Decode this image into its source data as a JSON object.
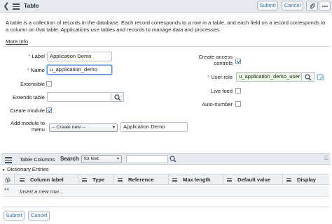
{
  "header": {
    "back_icon": "chevron-left-icon",
    "menu_icon": "hamburger-icon",
    "title": "Table",
    "submit_label": "Submit",
    "cancel_label": "Cancel",
    "attachment_icon": "paperclip-icon",
    "more_icon": "more-options-icon"
  },
  "description": "A table is a collection of records in the database. Each record corresponds to a row in a table, and each field on a record corresponds to a column on that table. Applications use tables and records to manage data and processes.",
  "more_info_label": "More Info",
  "form": {
    "label": {
      "label": "Label",
      "value": "Application Demo"
    },
    "name": {
      "label": "Name",
      "value": "u_application_demo"
    },
    "extensible": {
      "label": "Extensible",
      "checked": false
    },
    "extends_table": {
      "label": "Extends table",
      "value": ""
    },
    "create_module": {
      "label": "Create module",
      "checked": true
    },
    "add_module_to_menu": {
      "label_line1": "Add module to",
      "label_line2": "menu",
      "select_value": "-- Create new --",
      "value": "Application Demo"
    },
    "create_access_controls": {
      "label_line1": "Create access",
      "label_line2": "controls",
      "checked": true
    },
    "user_role": {
      "label": "User role",
      "value": "u_application_demo_user"
    },
    "live_feed": {
      "label": "Live feed",
      "checked": false
    },
    "auto_number": {
      "label": "Auto-number",
      "checked": false
    },
    "required_marker": "*"
  },
  "related_list": {
    "title": "Table Columns",
    "search_label": "Search",
    "search_field": "for text",
    "dictionary_label": "Dictionary Entries",
    "columns": [
      "Column label",
      "Type",
      "Reference",
      "Max length",
      "Default value",
      "Display"
    ],
    "new_row_text": "Insert a new row...",
    "new_row_marker": "**"
  },
  "footer": {
    "submit_label": "Submit",
    "cancel_label": "Cancel"
  },
  "colors": {
    "header_bg": "#e7eaee",
    "button_text": "#3b6fb2",
    "required": "#d9534f",
    "checkbox_check": "#2d5fb8",
    "role_field_bg": "#e9f7e4"
  }
}
